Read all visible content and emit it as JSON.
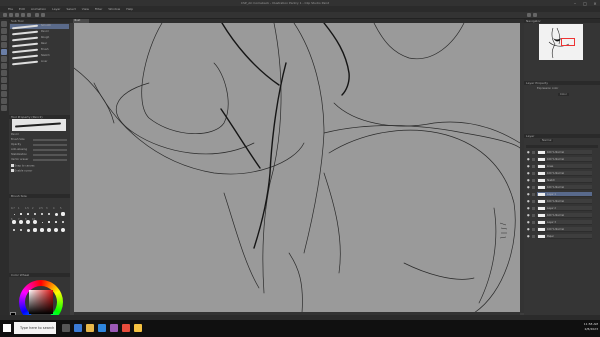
{
  "window": {
    "title": "CSP_AC Comeback - Illustration Pantry 1 - Clip Studio Paint",
    "app_icon": "clip-studio-icon",
    "controls": [
      "minimize-icon",
      "maximize-icon",
      "close-icon"
    ]
  },
  "menu": {
    "items": [
      "File",
      "Edit",
      "Animation",
      "Layer",
      "Select",
      "View",
      "Filter",
      "Window",
      "Help"
    ]
  },
  "tool_panel": {
    "title": "Sub Tool",
    "brushes": [
      {
        "label": "Smooth"
      },
      {
        "label": "Pencil"
      },
      {
        "label": "Rough"
      },
      {
        "label": "Real"
      },
      {
        "label": "Brush"
      },
      {
        "label": "Sketch"
      },
      {
        "label": "Liner"
      }
    ],
    "selected_index": 0
  },
  "tool_property": {
    "title": "Tool Property (Pencil)",
    "brush_name": "Pencil",
    "rows": [
      {
        "label": "Brush Size",
        "value": 0.22
      },
      {
        "label": "Opacity",
        "value": 1.0
      },
      {
        "label": "Anti-aliasing",
        "value": 0.6
      },
      {
        "label": "Stabilization",
        "value": 0.35
      },
      {
        "label": "Vector eraser",
        "value": 0.0
      }
    ],
    "checks": [
      "Snap to canvas",
      "Enable cursor"
    ]
  },
  "brush_size_panel": {
    "title": "Brush Size",
    "labels": [
      "0.7",
      "1",
      "1.5",
      "2",
      "2.5",
      "3",
      "4",
      "5",
      "6",
      "7",
      "8",
      "10"
    ]
  },
  "color": {
    "title": "Color Wheel",
    "fg": "#000000",
    "bg": "#ffffff",
    "hue_color": "#dd1111"
  },
  "canvas": {
    "tab_label": "Illust",
    "paper_color": "#9a9a9a",
    "line_color": "#1a1a1a"
  },
  "navigator": {
    "title": "Navigator"
  },
  "layer_property": {
    "title": "Layer Property",
    "expression_label": "Expression color",
    "expression_value": "Color"
  },
  "layers": {
    "title": "Layer",
    "blend_mode": "Normal",
    "items": [
      {
        "label": "100 % Normal"
      },
      {
        "label": "100 % Normal"
      },
      {
        "label": "Lines"
      },
      {
        "label": "100 % Normal"
      },
      {
        "label": "Sketch"
      },
      {
        "label": "100 % Normal"
      },
      {
        "label": "Layer 1"
      },
      {
        "label": "100 % Normal"
      },
      {
        "label": "Layer 2"
      },
      {
        "label": "100 % Normal"
      },
      {
        "label": "Layer 3"
      },
      {
        "label": "100 % Normal"
      },
      {
        "label": "Paper"
      }
    ],
    "selected_index": 6
  },
  "taskbar": {
    "search_placeholder": "Type here to search",
    "time": "11:58 AM",
    "date": "2/8/2023"
  }
}
